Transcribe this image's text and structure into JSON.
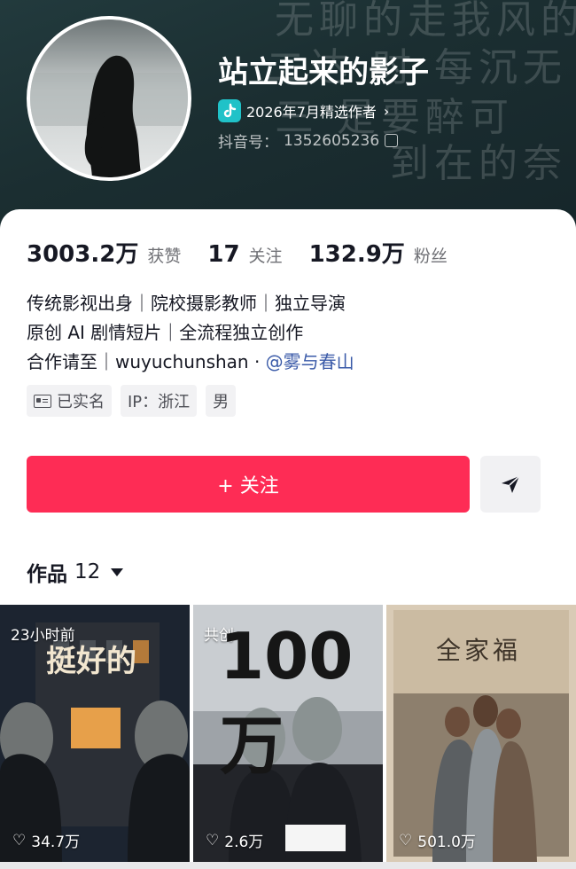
{
  "header": {
    "nickname": "站立起来的影子",
    "badge_label": "2026年7月精选作者",
    "douyin_id_label": "抖音号：",
    "douyin_id": "1352605236"
  },
  "stats": [
    {
      "num": "3003.2万",
      "label": "获赞"
    },
    {
      "num": "17",
      "label": "关注"
    },
    {
      "num": "132.9万",
      "label": "粉丝"
    }
  ],
  "bio": {
    "line1": "传统影视出身｜院校摄影教师｜独立导演",
    "line2": "原创 AI 剧情短片｜全流程独立创作",
    "line3_prefix": "合作请至｜wuyuchunshan · ",
    "mention": "@雾与春山"
  },
  "tags": [
    "已实名",
    "IP：浙江",
    "男"
  ],
  "actions": {
    "follow_label": "+ 关注"
  },
  "works": {
    "label": "作品",
    "count": "12"
  },
  "videos": [
    {
      "label": "23小时前",
      "title": "挺好的",
      "likes": "34.7万"
    },
    {
      "label": "共创",
      "title": "100万",
      "likes": "2.6万"
    },
    {
      "label": "",
      "title": "全家福",
      "likes": "501.0万"
    }
  ],
  "colors": {
    "accent": "#fe2c55",
    "header_bg": "#1e3336",
    "mention": "#3a5aa8"
  }
}
